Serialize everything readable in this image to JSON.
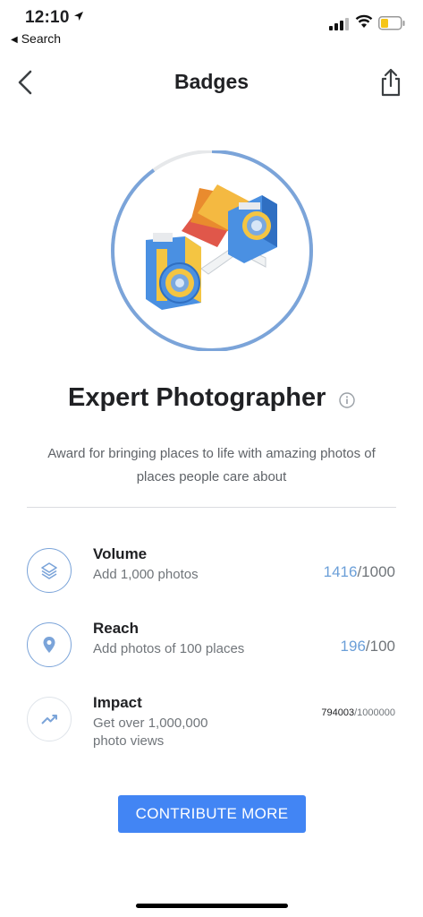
{
  "status_bar": {
    "time": "12:10",
    "back_app": "Search",
    "icons": [
      "location-arrow-icon",
      "signal-icon",
      "wifi-icon",
      "battery-icon"
    ],
    "battery_color": "#f5c518"
  },
  "header": {
    "title": "Badges",
    "back_icon": "chevron-left-icon",
    "share_icon": "share-icon"
  },
  "badge": {
    "title": "Expert Photographer",
    "info_icon": "info-icon",
    "description": "Award for bringing places to life with amazing photos of places people care about",
    "progress_fraction": 0.9
  },
  "requirements": [
    {
      "icon": "layers-icon",
      "name": "Volume",
      "subtitle": "Add 1,000 photos",
      "current": "1416",
      "target": "/1000"
    },
    {
      "icon": "map-pin-icon",
      "name": "Reach",
      "subtitle": "Add photos of 100 places",
      "current": "196",
      "target": "/100"
    },
    {
      "icon": "trending-up-icon",
      "name": "Impact",
      "subtitle": "Get over 1,000,000 photo views",
      "current": "794003",
      "target": "/1000000"
    }
  ],
  "cta_label": "CONTRIBUTE MORE",
  "colors": {
    "accent": "#4285f4",
    "progress_ring": "#7ba4d9",
    "count_highlight": "#6b9fd8"
  }
}
